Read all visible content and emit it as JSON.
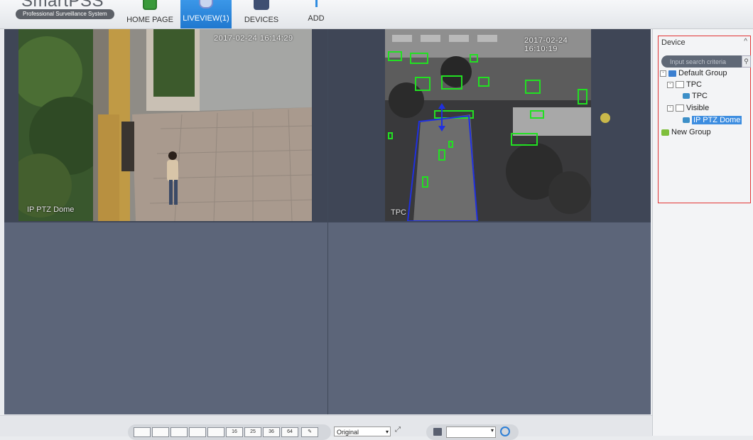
{
  "brand": {
    "title": "SmartPSS",
    "subtitle": "Professional Surveillance System"
  },
  "nav": {
    "tabs": [
      {
        "label": "HOME PAGE",
        "active": false,
        "icon": "home-icon"
      },
      {
        "label": "LIVEVIEW(1)",
        "active": true,
        "icon": "liveview-icon"
      },
      {
        "label": "DEVICES",
        "active": false,
        "icon": "devices-icon"
      },
      {
        "label": "ADD",
        "active": false,
        "icon": "add-icon"
      }
    ]
  },
  "video": {
    "cells": [
      {
        "label": "IP PTZ Dome",
        "timestamp": "2017-02-24 16:14:29"
      },
      {
        "label": "TPC",
        "timestamp": "2017-02-24 16:10:19"
      }
    ],
    "overlay_colors": {
      "detection": "#22e022",
      "zone": "#2030e0"
    }
  },
  "toolbar": {
    "layout_buttons": [
      "",
      "",
      "",
      "",
      "",
      "16",
      "25",
      "36",
      "64"
    ],
    "view_mode": "Original",
    "stream_value": ""
  },
  "panel": {
    "title": "Device",
    "search_placeholder": "Input search criteria",
    "tree": [
      {
        "label": "Default Group",
        "icon": "group-icon"
      },
      {
        "label": "TPC",
        "icon": "folder-icon"
      },
      {
        "label": "TPC",
        "icon": "camera-icon"
      },
      {
        "label": "Visible",
        "icon": "folder-icon"
      },
      {
        "label": "IP PTZ Dome",
        "icon": "camera-icon",
        "selected": true
      },
      {
        "label": "New Group",
        "icon": "new-group-icon"
      }
    ],
    "border_color": "#e23434"
  }
}
